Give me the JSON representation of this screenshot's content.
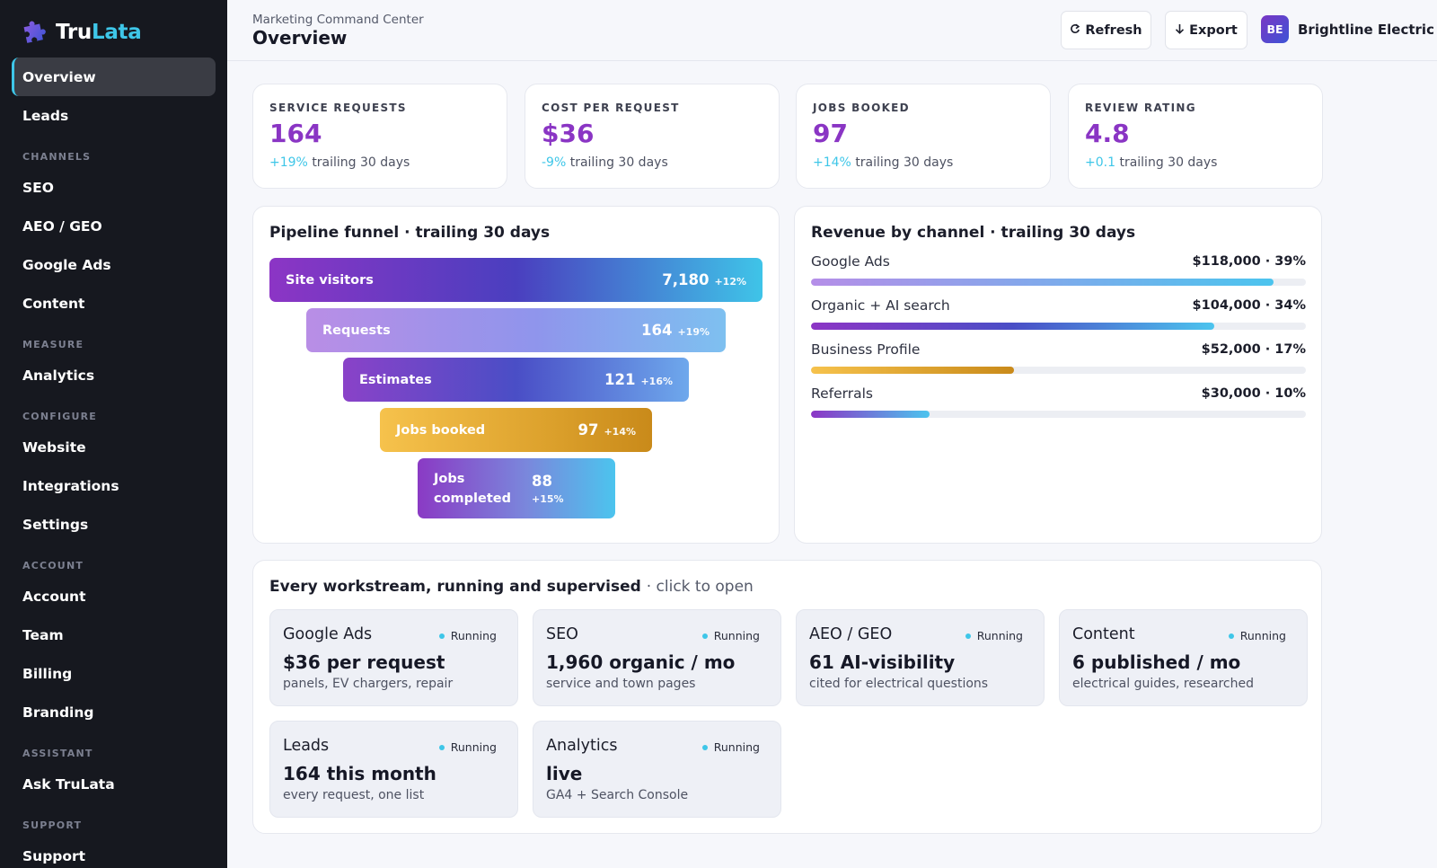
{
  "brand": {
    "name_part1": "Tru",
    "name_part2": "Lata",
    "logo_icon": "puzzle-icon"
  },
  "sidebar": {
    "items": [
      {
        "type": "item",
        "label": "Overview",
        "active": true
      },
      {
        "type": "item",
        "label": "Leads"
      },
      {
        "type": "section",
        "label": "CHANNELS"
      },
      {
        "type": "item",
        "label": "SEO"
      },
      {
        "type": "item",
        "label": "AEO / GEO"
      },
      {
        "type": "item",
        "label": "Google Ads"
      },
      {
        "type": "item",
        "label": "Content"
      },
      {
        "type": "section",
        "label": "MEASURE"
      },
      {
        "type": "item",
        "label": "Analytics"
      },
      {
        "type": "section",
        "label": "CONFIGURE"
      },
      {
        "type": "item",
        "label": "Website"
      },
      {
        "type": "item",
        "label": "Integrations"
      },
      {
        "type": "item",
        "label": "Settings"
      },
      {
        "type": "section",
        "label": "ACCOUNT"
      },
      {
        "type": "item",
        "label": "Account"
      },
      {
        "type": "item",
        "label": "Team"
      },
      {
        "type": "item",
        "label": "Billing"
      },
      {
        "type": "item",
        "label": "Branding"
      },
      {
        "type": "section",
        "label": "ASSISTANT"
      },
      {
        "type": "item",
        "label": "Ask TruLata"
      },
      {
        "type": "section",
        "label": "SUPPORT"
      },
      {
        "type": "item",
        "label": "Support"
      }
    ]
  },
  "header": {
    "subtitle": "Marketing Command Center",
    "title": "Overview",
    "refresh_label": "Refresh",
    "refresh_icon": "refresh-icon",
    "export_label": "Export",
    "export_icon": "arrow-down-icon",
    "account_initials": "BE",
    "account_name": "Brightline Electric"
  },
  "kpis": [
    {
      "label": "SERVICE REQUESTS",
      "value": "164",
      "delta": "+19%",
      "period": "trailing 30 days"
    },
    {
      "label": "COST PER REQUEST",
      "value": "$36",
      "delta": "-9%",
      "period": "trailing 30 days"
    },
    {
      "label": "JOBS BOOKED",
      "value": "97",
      "delta": "+14%",
      "period": "trailing 30 days"
    },
    {
      "label": "REVIEW RATING",
      "value": "4.8",
      "delta": "+0.1",
      "period": "trailing 30 days"
    }
  ],
  "funnel": {
    "title": "Pipeline funnel · trailing 30 days",
    "stages": [
      {
        "label": "Site visitors",
        "value": "7,180",
        "delta": "+12%"
      },
      {
        "label": "Requests",
        "value": "164",
        "delta": "+19%"
      },
      {
        "label": "Estimates",
        "value": "121",
        "delta": "+16%"
      },
      {
        "label": "Jobs booked",
        "value": "97",
        "delta": "+14%"
      },
      {
        "label": "Jobs completed",
        "value": "88",
        "delta": "+15%"
      }
    ]
  },
  "revenue": {
    "title": "Revenue by channel · trailing 30 days",
    "channels": [
      {
        "name": "Google Ads",
        "amount": "$118,000 · 39%",
        "fill": 0.935,
        "gradient": [
          "#b58ee8",
          "#4cc4ee"
        ]
      },
      {
        "name": "Organic + AI search",
        "amount": "$104,000 · 34%",
        "fill": 0.815,
        "gradient": [
          "#8c35c5",
          "#4a4ec6",
          "#4cc4ee"
        ]
      },
      {
        "name": "Business Profile",
        "amount": "$52,000 · 17%",
        "fill": 0.41,
        "gradient": [
          "#f6c24c",
          "#c98a1a"
        ]
      },
      {
        "name": "Referrals",
        "amount": "$30,000 · 10%",
        "fill": 0.24,
        "gradient": [
          "#8c35c5",
          "#4cc4ee"
        ]
      }
    ]
  },
  "workstreams": {
    "title": "Every workstream, running and supervised",
    "title_suffix": "· click to open",
    "items": [
      {
        "name": "Google Ads",
        "status": "Running",
        "metric": "$36 per request",
        "sub": "panels, EV chargers, repair"
      },
      {
        "name": "SEO",
        "status": "Running",
        "metric": "1,960 organic / mo",
        "sub": "service and town pages"
      },
      {
        "name": "AEO / GEO",
        "status": "Running",
        "metric": "61 AI-visibility",
        "sub": "cited for electrical questions"
      },
      {
        "name": "Content",
        "status": "Running",
        "metric": "6 published / mo",
        "sub": "electrical guides, researched"
      },
      {
        "name": "Leads",
        "status": "Running",
        "metric": "164 this month",
        "sub": "every request, one list"
      },
      {
        "name": "Analytics",
        "status": "Running",
        "metric": "live",
        "sub": "GA4 + Search Console"
      }
    ]
  },
  "colors": {
    "accent_purple": "#8a35c4",
    "accent_cyan": "#3ec6e8",
    "sidebar_bg": "#16181f"
  }
}
